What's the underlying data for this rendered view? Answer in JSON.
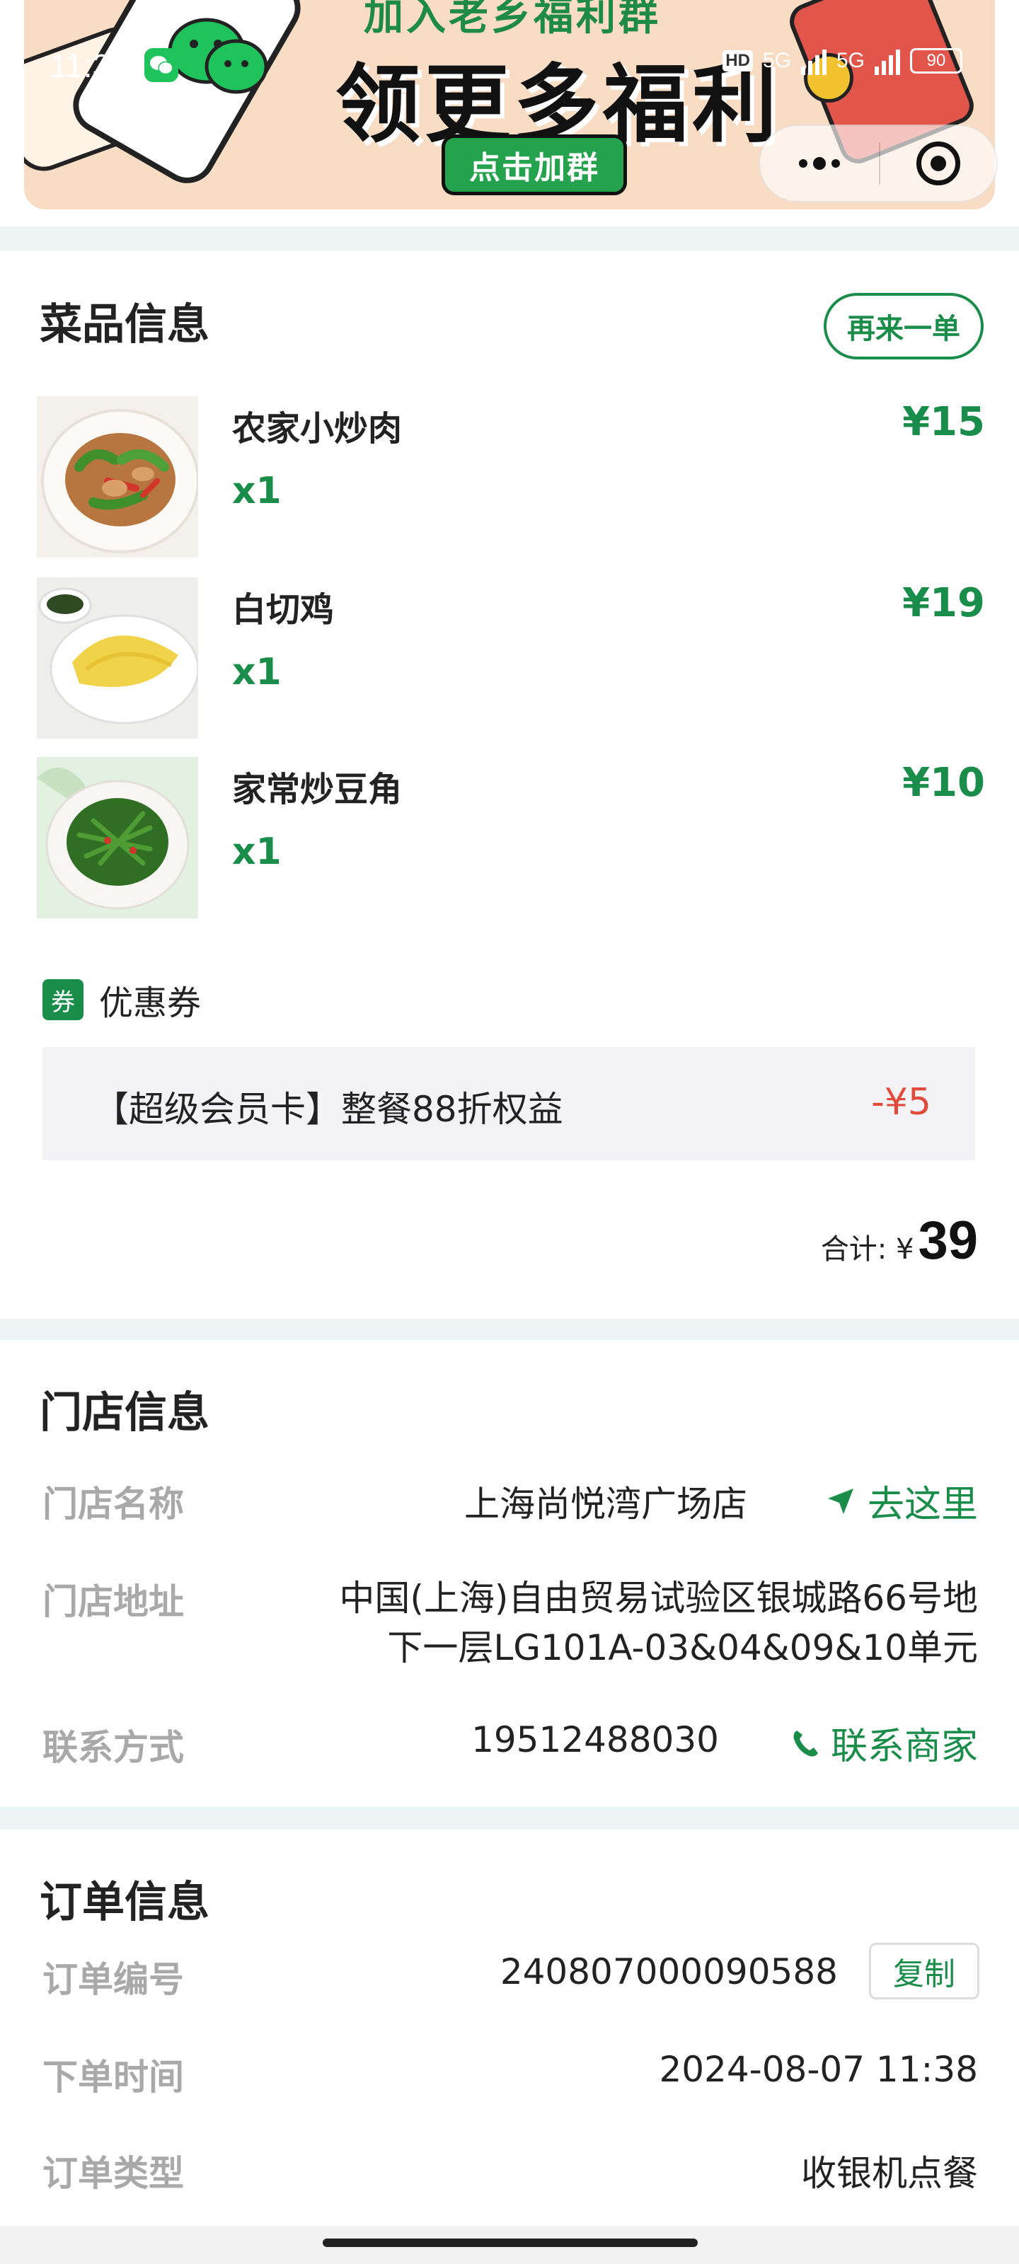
{
  "status_bar": {
    "time": "11:39",
    "hd_label": "HD",
    "network_1": "5G",
    "network_2": "5G",
    "battery": "90"
  },
  "banner": {
    "title_top": "加入老乡福利群",
    "title": "领更多福利",
    "button_label": "点击加群"
  },
  "dishes_section": {
    "title": "菜品信息",
    "reorder_label": "再来一单",
    "items": [
      {
        "name": "农家小炒肉",
        "qty": "x1",
        "price": "¥15"
      },
      {
        "name": "白切鸡",
        "qty": "x1",
        "price": "¥19"
      },
      {
        "name": "家常炒豆角",
        "qty": "x1",
        "price": "¥10"
      }
    ],
    "coupon": {
      "tag": "券",
      "label": "优惠券",
      "name": "【超级会员卡】整餐88折权益",
      "discount": "-¥5"
    },
    "total_label": "合计: ¥",
    "total_value": "39"
  },
  "store_section": {
    "title": "门店信息",
    "name_label": "门店名称",
    "name_value": "上海尚悦湾广场店",
    "navigate_label": "去这里",
    "address_label": "门店地址",
    "address_line1": "中国(上海)自由贸易试验区银城路66号地",
    "address_line2": "下一层LG101A-03&04&09&10单元",
    "contact_label": "联系方式",
    "contact_value": "19512488030",
    "call_label": "联系商家"
  },
  "order_section": {
    "title": "订单信息",
    "number_label": "订单编号",
    "number_value": "240807000090588",
    "copy_label": "复制",
    "time_label": "下单时间",
    "time_value": "2024-08-07 11:38",
    "type_label": "订单类型",
    "type_value": "收银机点餐"
  },
  "colors": {
    "brand_green": "#1a8d4b",
    "discount_red": "#e04b3b",
    "label_gray": "#a9a9a9"
  }
}
